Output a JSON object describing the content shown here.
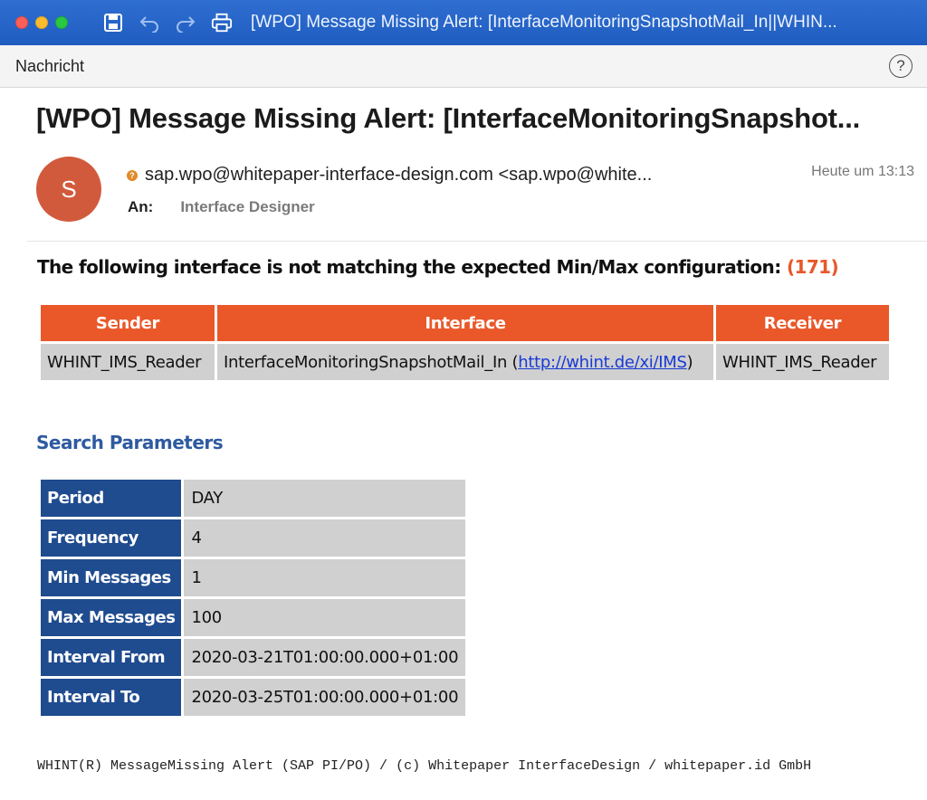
{
  "window": {
    "title": "[WPO] Message Missing Alert: [InterfaceMonitoringSnapshotMail_In||WHIN..."
  },
  "toolbar": {
    "tab_label": "Nachricht",
    "help_label": "?"
  },
  "message": {
    "subject": "[WPO] Message Missing Alert: [InterfaceMonitoringSnapshot...",
    "avatar_initial": "S",
    "from": "sap.wpo@whitepaper-interface-design.com <sap.wpo@white...",
    "date": "Heute um 13:13",
    "to_label": "An:",
    "to_name": "Interface Designer"
  },
  "body": {
    "intro_text": "The following interface is not matching the expected Min/Max configuration: ",
    "intro_count": "(171)",
    "interface_table": {
      "headers": [
        "Sender",
        "Interface",
        "Receiver"
      ],
      "row": {
        "sender": "WHINT_IMS_Reader",
        "interface_name": "InterfaceMonitoringSnapshotMail_In (",
        "interface_link": "http://whint.de/xi/IMS",
        "interface_close": ")",
        "receiver": "WHINT_IMS_Reader"
      }
    },
    "search_title": "Search Parameters",
    "params": [
      {
        "label": "Period",
        "value": "DAY"
      },
      {
        "label": "Frequency",
        "value": "4"
      },
      {
        "label": "Min Messages",
        "value": "1"
      },
      {
        "label": "Max Messages",
        "value": "100"
      },
      {
        "label": "Interval From",
        "value": "2020-03-21T01:00:00.000+01:00"
      },
      {
        "label": "Interval To",
        "value": "2020-03-25T01:00:00.000+01:00"
      }
    ],
    "footer": "WHINT(R) MessageMissing Alert (SAP PI/PO) / (c) Whitepaper InterfaceDesign / whitepaper.id GmbH"
  },
  "colors": {
    "titlebar": "#1f5cc0",
    "orange_header": "#ea582a",
    "blue_header": "#1f4b8f",
    "cell_gray": "#d0d0d0",
    "section_title": "#2e5aa0",
    "avatar": "#d25a3c"
  },
  "icons": [
    "close-window-icon",
    "minimize-window-icon",
    "zoom-window-icon",
    "save-icon",
    "undo-icon",
    "redo-icon",
    "print-icon",
    "help-icon",
    "sender-status-icon"
  ]
}
